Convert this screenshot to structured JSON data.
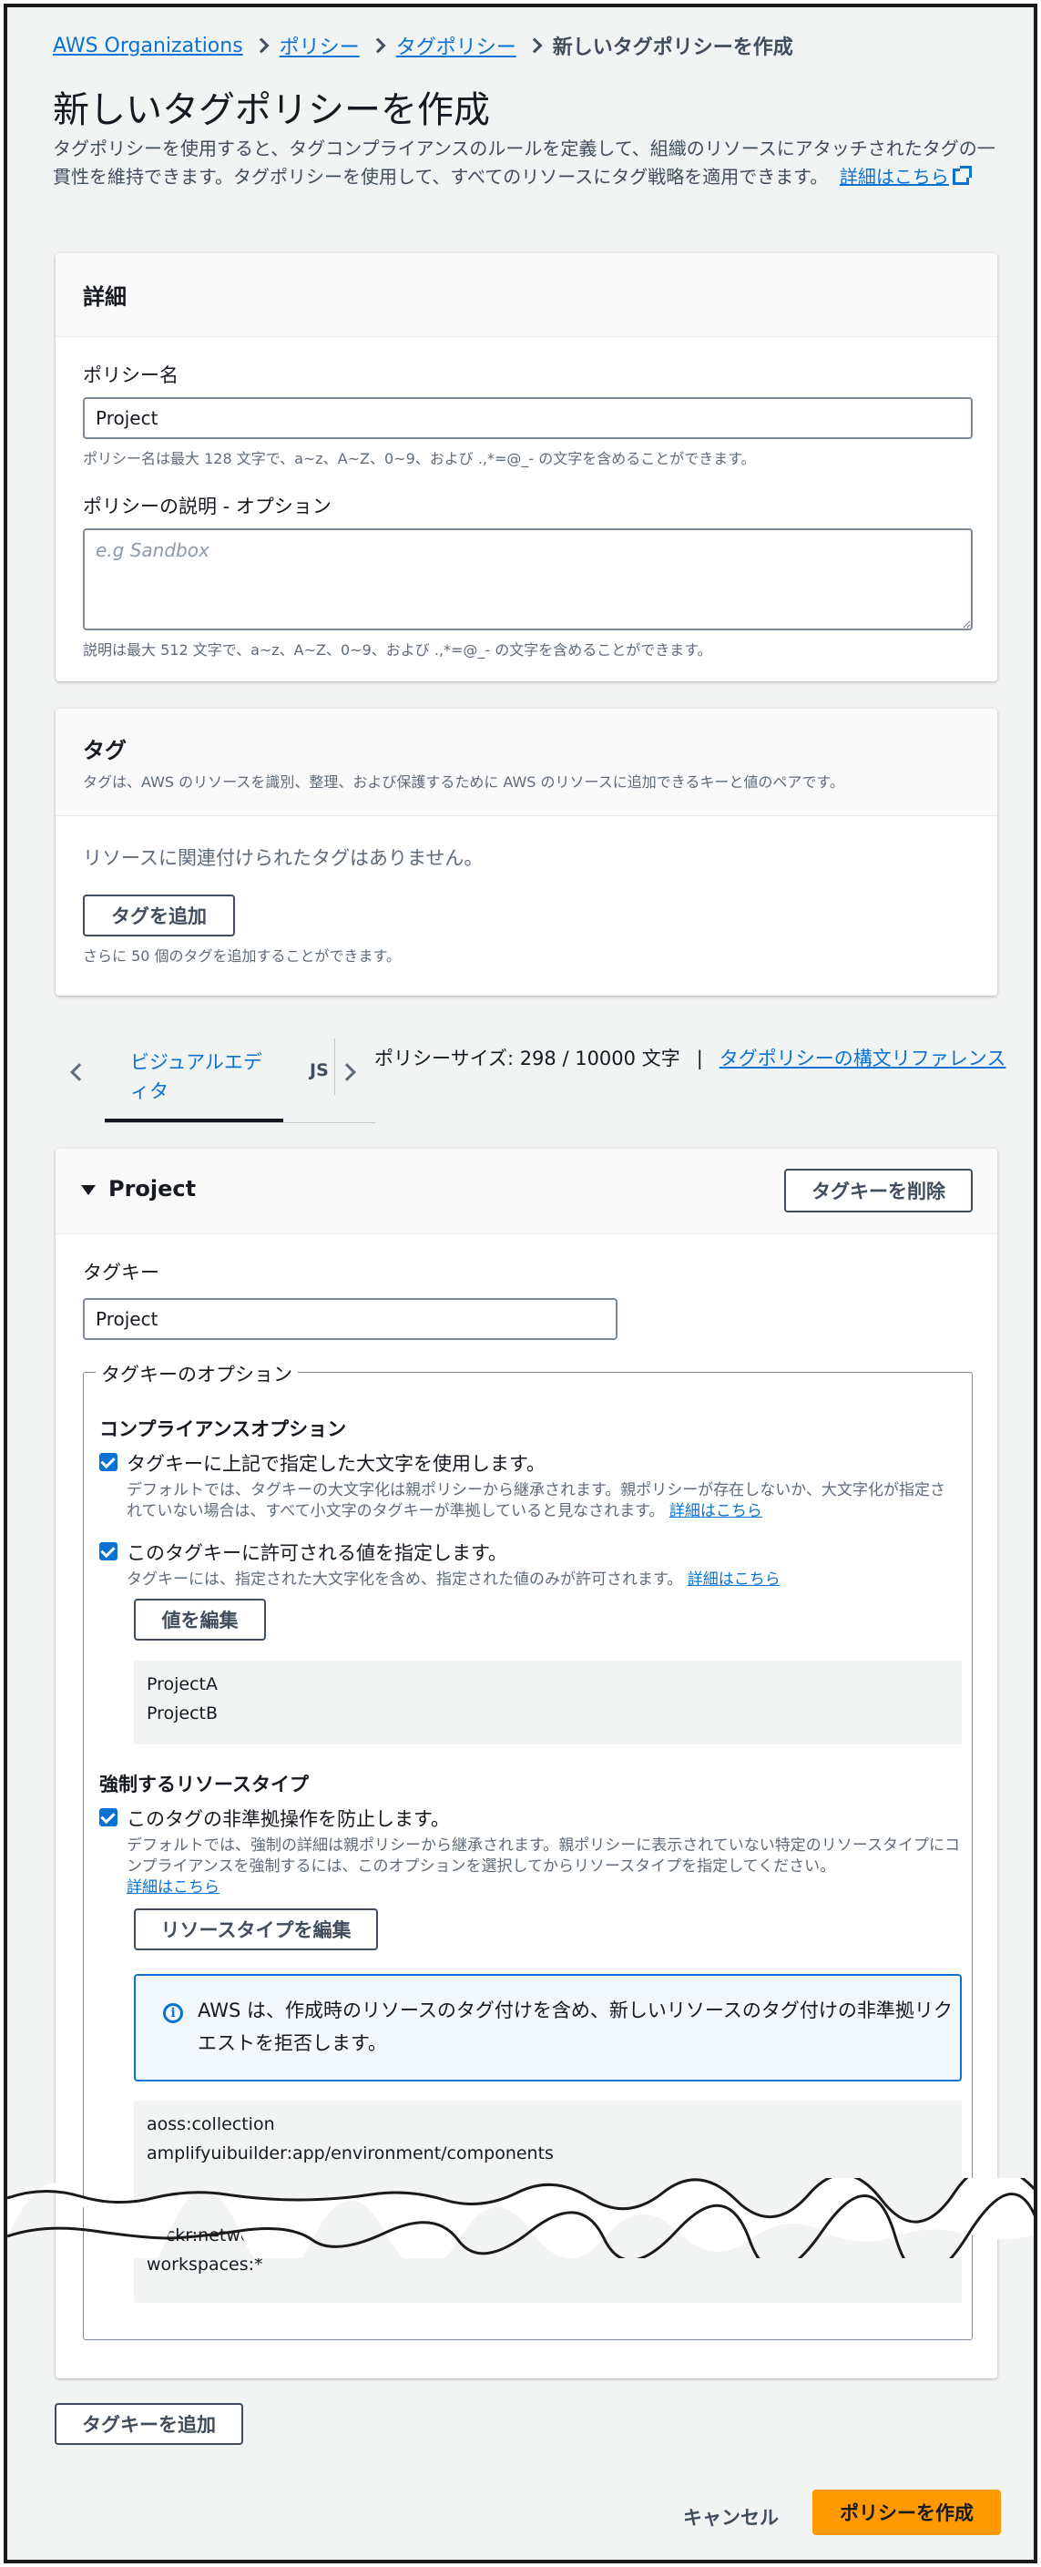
{
  "breadcrumb": {
    "items": [
      "AWS Organizations",
      "ポリシー",
      "タグポリシー"
    ],
    "current": "新しいタグポリシーを作成"
  },
  "page": {
    "title": "新しいタグポリシーを作成",
    "description": "タグポリシーを使用すると、タグコンプライアンスのルールを定義して、組織のリソースにアタッチされたタグの一貫性を維持できます。タグポリシーを使用して、すべてのリソースにタグ戦略を適用できます。",
    "learn_more": "詳細はこちら"
  },
  "details": {
    "title": "詳細",
    "name_label": "ポリシー名",
    "name_value": "Project",
    "name_hint": "ポリシー名は最大 128 文字で、a~z、A~Z、0~9、および .,*=@_- の文字を含めることができます。",
    "desc_label": "ポリシーの説明 - オプション",
    "desc_placeholder": "e.g Sandbox",
    "desc_hint": "説明は最大 512 文字で、a~z、A~Z、0~9、および .,*=@_- の文字を含めることができます。"
  },
  "tags": {
    "title": "タグ",
    "subtitle": "タグは、AWS のリソースを識別、整理、および保護するために AWS のリソースに追加できるキーと値のペアです。",
    "empty": "リソースに関連付けられたタグはありません。",
    "add_button": "タグを追加",
    "limit_hint": "さらに 50 個のタグを追加することができます。"
  },
  "tabs": {
    "visual": "ビジュアルエディタ",
    "json_partial": "JS",
    "size_text": "ポリシーサイズ: 298 / 10000 文字",
    "separator": "|",
    "syntax_link": "タグポリシーの構文リファレンス"
  },
  "tagkey": {
    "title": "Project",
    "remove_button": "タグキーを削除",
    "key_label": "タグキー",
    "key_value": "Project",
    "options_legend": "タグキーのオプション",
    "compliance_title": "コンプライアンスオプション",
    "opt1_label": "タグキーに上記で指定した大文字を使用します。",
    "opt1_desc": "デフォルトでは、タグキーの大文字化は親ポリシーから継承されます。親ポリシーが存在しないか、大文字化が指定されていない場合は、すべて小文字のタグキーが準拠していると見なされます。",
    "opt1_link": "詳細はこちら",
    "opt2_label": "このタグキーに許可される値を指定します。",
    "opt2_desc": "タグキーには、指定された大文字化を含め、指定された値のみが許可されます。",
    "opt2_link": "詳細はこちら",
    "edit_values_button": "値を編集",
    "values": [
      "ProjectA",
      "ProjectB"
    ],
    "enforce_title": "強制するリソースタイプ",
    "opt3_label": "このタグの非準拠操作を防止します。",
    "opt3_desc": "デフォルトでは、強制の詳細は親ポリシーから継承されます。親ポリシーに表示されていない特定のリソースタイプにコンプライアンスを強制するには、このオプションを選択してからリソースタイプを指定してください。",
    "opt3_link": "詳細はこちら",
    "edit_resources_button": "リソースタイプを編集",
    "alert_text": "AWS は、作成時のリソースのタグ付けを含め、新しいリソースのタグ付けの非準拠リクエストを拒否します。",
    "resources_top": [
      "aoss:collection",
      "amplifyuibuilder:app/environment/components"
    ],
    "resources_bottom": [
      "wickr:network",
      "workspaces:*"
    ]
  },
  "footer": {
    "add_tagkey_button": "タグキーを追加",
    "cancel": "キャンセル",
    "create": "ポリシーを作成"
  },
  "colors": {
    "primary_button": "#ff9900",
    "link": "#0972d3",
    "background": "#f2f3f3"
  }
}
